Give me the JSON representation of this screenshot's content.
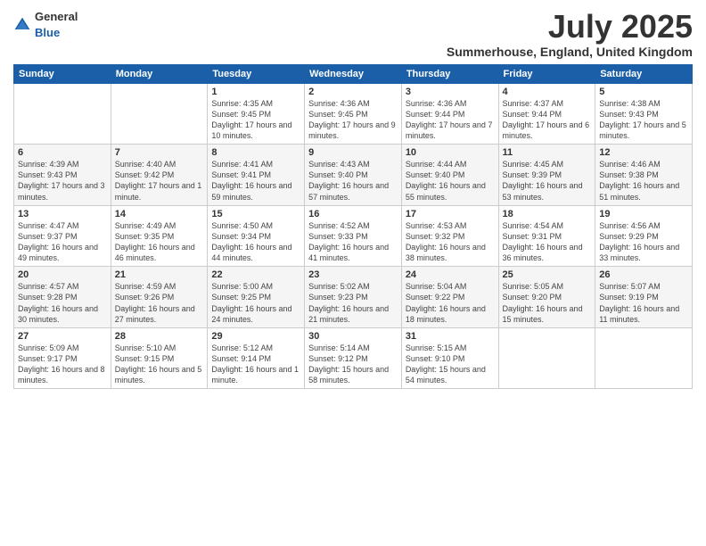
{
  "logo": {
    "general": "General",
    "blue": "Blue"
  },
  "header": {
    "month": "July 2025",
    "location": "Summerhouse, England, United Kingdom"
  },
  "days_of_week": [
    "Sunday",
    "Monday",
    "Tuesday",
    "Wednesday",
    "Thursday",
    "Friday",
    "Saturday"
  ],
  "weeks": [
    [
      {
        "day": "",
        "sunrise": "",
        "sunset": "",
        "daylight": ""
      },
      {
        "day": "",
        "sunrise": "",
        "sunset": "",
        "daylight": ""
      },
      {
        "day": "1",
        "sunrise": "Sunrise: 4:35 AM",
        "sunset": "Sunset: 9:45 PM",
        "daylight": "Daylight: 17 hours and 10 minutes."
      },
      {
        "day": "2",
        "sunrise": "Sunrise: 4:36 AM",
        "sunset": "Sunset: 9:45 PM",
        "daylight": "Daylight: 17 hours and 9 minutes."
      },
      {
        "day": "3",
        "sunrise": "Sunrise: 4:36 AM",
        "sunset": "Sunset: 9:44 PM",
        "daylight": "Daylight: 17 hours and 7 minutes."
      },
      {
        "day": "4",
        "sunrise": "Sunrise: 4:37 AM",
        "sunset": "Sunset: 9:44 PM",
        "daylight": "Daylight: 17 hours and 6 minutes."
      },
      {
        "day": "5",
        "sunrise": "Sunrise: 4:38 AM",
        "sunset": "Sunset: 9:43 PM",
        "daylight": "Daylight: 17 hours and 5 minutes."
      }
    ],
    [
      {
        "day": "6",
        "sunrise": "Sunrise: 4:39 AM",
        "sunset": "Sunset: 9:43 PM",
        "daylight": "Daylight: 17 hours and 3 minutes."
      },
      {
        "day": "7",
        "sunrise": "Sunrise: 4:40 AM",
        "sunset": "Sunset: 9:42 PM",
        "daylight": "Daylight: 17 hours and 1 minute."
      },
      {
        "day": "8",
        "sunrise": "Sunrise: 4:41 AM",
        "sunset": "Sunset: 9:41 PM",
        "daylight": "Daylight: 16 hours and 59 minutes."
      },
      {
        "day": "9",
        "sunrise": "Sunrise: 4:43 AM",
        "sunset": "Sunset: 9:40 PM",
        "daylight": "Daylight: 16 hours and 57 minutes."
      },
      {
        "day": "10",
        "sunrise": "Sunrise: 4:44 AM",
        "sunset": "Sunset: 9:40 PM",
        "daylight": "Daylight: 16 hours and 55 minutes."
      },
      {
        "day": "11",
        "sunrise": "Sunrise: 4:45 AM",
        "sunset": "Sunset: 9:39 PM",
        "daylight": "Daylight: 16 hours and 53 minutes."
      },
      {
        "day": "12",
        "sunrise": "Sunrise: 4:46 AM",
        "sunset": "Sunset: 9:38 PM",
        "daylight": "Daylight: 16 hours and 51 minutes."
      }
    ],
    [
      {
        "day": "13",
        "sunrise": "Sunrise: 4:47 AM",
        "sunset": "Sunset: 9:37 PM",
        "daylight": "Daylight: 16 hours and 49 minutes."
      },
      {
        "day": "14",
        "sunrise": "Sunrise: 4:49 AM",
        "sunset": "Sunset: 9:35 PM",
        "daylight": "Daylight: 16 hours and 46 minutes."
      },
      {
        "day": "15",
        "sunrise": "Sunrise: 4:50 AM",
        "sunset": "Sunset: 9:34 PM",
        "daylight": "Daylight: 16 hours and 44 minutes."
      },
      {
        "day": "16",
        "sunrise": "Sunrise: 4:52 AM",
        "sunset": "Sunset: 9:33 PM",
        "daylight": "Daylight: 16 hours and 41 minutes."
      },
      {
        "day": "17",
        "sunrise": "Sunrise: 4:53 AM",
        "sunset": "Sunset: 9:32 PM",
        "daylight": "Daylight: 16 hours and 38 minutes."
      },
      {
        "day": "18",
        "sunrise": "Sunrise: 4:54 AM",
        "sunset": "Sunset: 9:31 PM",
        "daylight": "Daylight: 16 hours and 36 minutes."
      },
      {
        "day": "19",
        "sunrise": "Sunrise: 4:56 AM",
        "sunset": "Sunset: 9:29 PM",
        "daylight": "Daylight: 16 hours and 33 minutes."
      }
    ],
    [
      {
        "day": "20",
        "sunrise": "Sunrise: 4:57 AM",
        "sunset": "Sunset: 9:28 PM",
        "daylight": "Daylight: 16 hours and 30 minutes."
      },
      {
        "day": "21",
        "sunrise": "Sunrise: 4:59 AM",
        "sunset": "Sunset: 9:26 PM",
        "daylight": "Daylight: 16 hours and 27 minutes."
      },
      {
        "day": "22",
        "sunrise": "Sunrise: 5:00 AM",
        "sunset": "Sunset: 9:25 PM",
        "daylight": "Daylight: 16 hours and 24 minutes."
      },
      {
        "day": "23",
        "sunrise": "Sunrise: 5:02 AM",
        "sunset": "Sunset: 9:23 PM",
        "daylight": "Daylight: 16 hours and 21 minutes."
      },
      {
        "day": "24",
        "sunrise": "Sunrise: 5:04 AM",
        "sunset": "Sunset: 9:22 PM",
        "daylight": "Daylight: 16 hours and 18 minutes."
      },
      {
        "day": "25",
        "sunrise": "Sunrise: 5:05 AM",
        "sunset": "Sunset: 9:20 PM",
        "daylight": "Daylight: 16 hours and 15 minutes."
      },
      {
        "day": "26",
        "sunrise": "Sunrise: 5:07 AM",
        "sunset": "Sunset: 9:19 PM",
        "daylight": "Daylight: 16 hours and 11 minutes."
      }
    ],
    [
      {
        "day": "27",
        "sunrise": "Sunrise: 5:09 AM",
        "sunset": "Sunset: 9:17 PM",
        "daylight": "Daylight: 16 hours and 8 minutes."
      },
      {
        "day": "28",
        "sunrise": "Sunrise: 5:10 AM",
        "sunset": "Sunset: 9:15 PM",
        "daylight": "Daylight: 16 hours and 5 minutes."
      },
      {
        "day": "29",
        "sunrise": "Sunrise: 5:12 AM",
        "sunset": "Sunset: 9:14 PM",
        "daylight": "Daylight: 16 hours and 1 minute."
      },
      {
        "day": "30",
        "sunrise": "Sunrise: 5:14 AM",
        "sunset": "Sunset: 9:12 PM",
        "daylight": "Daylight: 15 hours and 58 minutes."
      },
      {
        "day": "31",
        "sunrise": "Sunrise: 5:15 AM",
        "sunset": "Sunset: 9:10 PM",
        "daylight": "Daylight: 15 hours and 54 minutes."
      },
      {
        "day": "",
        "sunrise": "",
        "sunset": "",
        "daylight": ""
      },
      {
        "day": "",
        "sunrise": "",
        "sunset": "",
        "daylight": ""
      }
    ]
  ]
}
